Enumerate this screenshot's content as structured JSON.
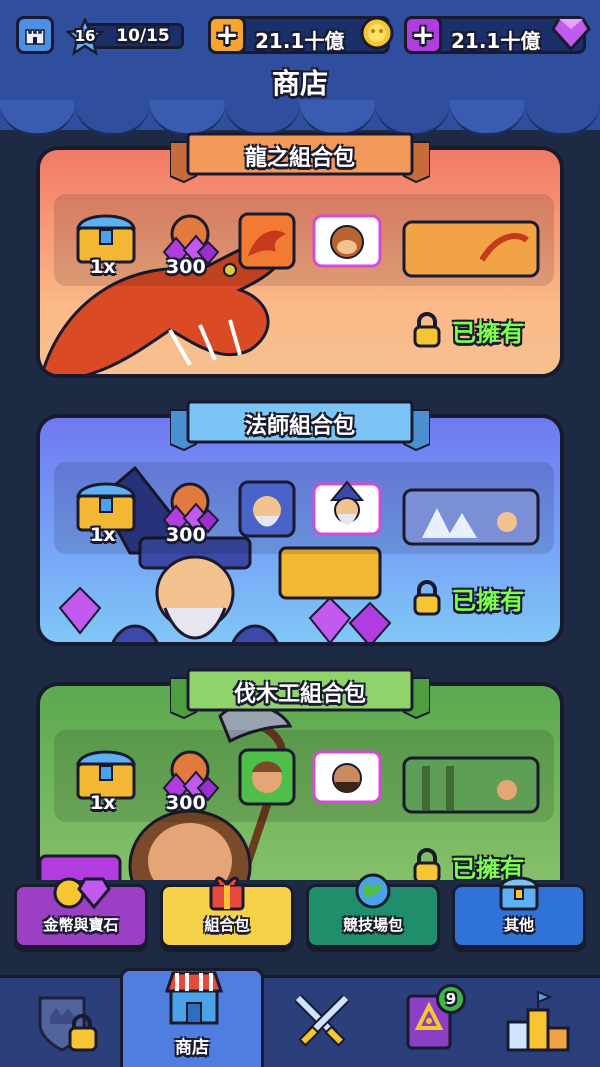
{
  "header": {
    "level": "16",
    "level_progress": "10/15",
    "coins": "21.1十億",
    "gems": "21.1十億",
    "title": "商店"
  },
  "bundles": [
    {
      "name": "龍之組合包",
      "chest_qty": "1x",
      "gem_qty": "300",
      "owned_label": "已擁有",
      "theme_color": "#f27a66",
      "ribbon_color": "#f39a5a"
    },
    {
      "name": "法師組合包",
      "chest_qty": "1x",
      "gem_qty": "300",
      "owned_label": "已擁有",
      "theme_color": "#6f79f2",
      "ribbon_color": "#7cc4f5"
    },
    {
      "name": "伐木工組合包",
      "chest_qty": "1x",
      "gem_qty": "300",
      "owned_label": "已擁有",
      "theme_color": "#5ca950",
      "ribbon_color": "#8fd36a"
    }
  ],
  "categories": [
    {
      "label": "金幣與寶石",
      "icon": "coins-gems-icon",
      "color": "#9b3fc4"
    },
    {
      "label": "組合包",
      "icon": "gift-icon",
      "color": "#f6d24a"
    },
    {
      "label": "競技場包",
      "icon": "globe-icon",
      "color": "#1e8f6a"
    },
    {
      "label": "其他",
      "icon": "chest-icon",
      "color": "#2f72d8"
    }
  ],
  "nav": {
    "shop_label": "商店",
    "quests_badge": "9"
  },
  "colors": {
    "accent_blue": "#2f4f9e",
    "owned_green": "#7cff4e",
    "gem_purple": "#b13ce0",
    "coin_gold": "#f7c531"
  }
}
